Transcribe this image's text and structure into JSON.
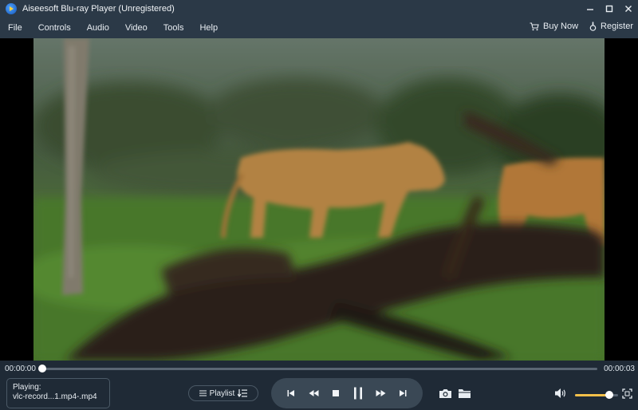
{
  "window": {
    "title": "Aiseesoft Blu-ray Player (Unregistered)"
  },
  "menu": {
    "items": [
      "File",
      "Controls",
      "Audio",
      "Video",
      "Tools",
      "Help"
    ],
    "buy_now": "Buy Now",
    "register": "Register"
  },
  "player": {
    "current_time": "00:00:00",
    "total_time": "00:00:03",
    "progress": 0.0,
    "now_playing_label": "Playing:",
    "now_playing_file": "vlc-record...1.mp4-.mp4",
    "playlist_label": "Playlist",
    "volume": 0.8
  },
  "icons": {
    "app": "app-logo-icon",
    "minimize": "minimize-icon",
    "maximize": "maximize-icon",
    "close": "close-icon",
    "cart": "cart-icon",
    "register": "register-icon",
    "playlist": "playlist-icon",
    "playlist_sort": "playlist-sort-icon",
    "prev": "skip-previous-icon",
    "rewind": "rewind-icon",
    "stop": "stop-icon",
    "pause": "pause-icon",
    "forward": "fast-forward-icon",
    "next": "skip-next-icon",
    "snapshot": "camera-icon",
    "open": "folder-icon",
    "volume": "volume-icon",
    "fullscreen": "fullscreen-icon"
  },
  "colors": {
    "chrome": "#2b3947",
    "control_bg": "#1f2a36",
    "transport_bg": "#3a4855",
    "volume_accent": "#f5c04a"
  }
}
